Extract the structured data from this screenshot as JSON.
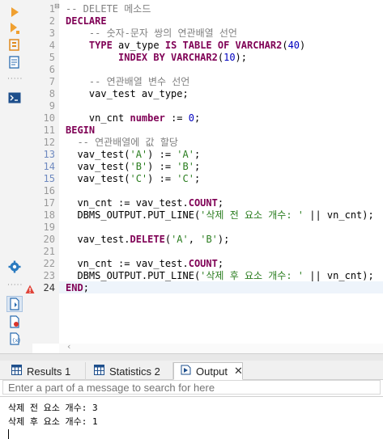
{
  "toolbar": {
    "icons": [
      "run-icon",
      "run-script-icon",
      "explain-plan-icon",
      "script-icon",
      "terminal-icon",
      "settings-icon",
      "active-file-icon",
      "file-error-icon",
      "variables-icon"
    ]
  },
  "editor": {
    "lines": [
      {
        "n": "1",
        "parts": [
          [
            "cm",
            "-- DELETE 메소드"
          ]
        ]
      },
      {
        "n": "2",
        "parts": [
          [
            "kw",
            "DECLARE"
          ]
        ]
      },
      {
        "n": "3",
        "parts": [
          [
            "",
            "    "
          ],
          [
            "cm",
            "-- 숫자-문자 쌍의 연관배열 선언"
          ]
        ]
      },
      {
        "n": "4",
        "parts": [
          [
            "",
            "    "
          ],
          [
            "kw",
            "TYPE"
          ],
          [
            "",
            " av_type "
          ],
          [
            "kw",
            "IS TABLE OF VARCHAR2"
          ],
          [
            "",
            "("
          ],
          [
            "num",
            "40"
          ],
          [
            "",
            ")"
          ]
        ]
      },
      {
        "n": "5",
        "parts": [
          [
            "",
            "         "
          ],
          [
            "kw",
            "INDEX BY VARCHAR2"
          ],
          [
            "",
            "("
          ],
          [
            "num",
            "10"
          ],
          [
            "",
            ");"
          ]
        ]
      },
      {
        "n": "6",
        "parts": []
      },
      {
        "n": "7",
        "parts": [
          [
            "",
            "    "
          ],
          [
            "cm",
            "-- 연관배열 변수 선언"
          ]
        ]
      },
      {
        "n": "8",
        "parts": [
          [
            "",
            "    vav_test av_type;"
          ]
        ]
      },
      {
        "n": "9",
        "parts": []
      },
      {
        "n": "10",
        "parts": [
          [
            "",
            "    vn_cnt "
          ],
          [
            "kw",
            "number"
          ],
          [
            "",
            " := "
          ],
          [
            "num",
            "0"
          ],
          [
            "",
            ";"
          ]
        ]
      },
      {
        "n": "11",
        "parts": [
          [
            "kw",
            "BEGIN"
          ]
        ]
      },
      {
        "n": "12",
        "parts": [
          [
            "",
            "  "
          ],
          [
            "cm",
            "-- 연관배열에 값 할당"
          ]
        ]
      },
      {
        "n": "13",
        "parts": [
          [
            "",
            "  vav_test("
          ],
          [
            "str",
            "'A'"
          ],
          [
            "",
            ") := "
          ],
          [
            "str",
            "'A'"
          ],
          [
            "",
            ";"
          ]
        ]
      },
      {
        "n": "14",
        "parts": [
          [
            "",
            "  vav_test("
          ],
          [
            "str",
            "'B'"
          ],
          [
            "",
            ") := "
          ],
          [
            "str",
            "'B'"
          ],
          [
            "",
            ";"
          ]
        ]
      },
      {
        "n": "15",
        "parts": [
          [
            "",
            "  vav_test("
          ],
          [
            "str",
            "'C'"
          ],
          [
            "",
            ") := "
          ],
          [
            "str",
            "'C'"
          ],
          [
            "",
            ";"
          ]
        ]
      },
      {
        "n": "16",
        "parts": []
      },
      {
        "n": "17",
        "parts": [
          [
            "",
            "  vn_cnt := vav_test."
          ],
          [
            "kw",
            "COUNT"
          ],
          [
            "",
            ";"
          ]
        ]
      },
      {
        "n": "18",
        "parts": [
          [
            "",
            "  DBMS_OUTPUT.PUT_LINE("
          ],
          [
            "str",
            "'삭제 전 요소 개수: '"
          ],
          [
            "",
            " || vn_cnt);"
          ]
        ]
      },
      {
        "n": "19",
        "parts": []
      },
      {
        "n": "20",
        "parts": [
          [
            "",
            "  vav_test."
          ],
          [
            "kw",
            "DELETE"
          ],
          [
            "",
            "("
          ],
          [
            "str",
            "'A'"
          ],
          [
            "",
            ", "
          ],
          [
            "str",
            "'B'"
          ],
          [
            "",
            ");"
          ]
        ]
      },
      {
        "n": "21",
        "parts": []
      },
      {
        "n": "22",
        "parts": [
          [
            "",
            "  vn_cnt := vav_test."
          ],
          [
            "kw",
            "COUNT"
          ],
          [
            "",
            ";"
          ]
        ]
      },
      {
        "n": "23",
        "parts": [
          [
            "",
            "  DBMS_OUTPUT.PUT_LINE("
          ],
          [
            "str",
            "'삭제 후 요소 개수: '"
          ],
          [
            "",
            " || vn_cnt);"
          ]
        ]
      },
      {
        "n": "24",
        "parts": [
          [
            "kw",
            "END"
          ],
          [
            "",
            ";"
          ]
        ]
      }
    ],
    "modified_lines": [
      "13",
      "14",
      "15"
    ],
    "current_line": "24",
    "warning_line": "23"
  },
  "panel": {
    "tabs": [
      {
        "label": "Results 1",
        "icon": "grid-icon",
        "active": false
      },
      {
        "label": "Statistics 2",
        "icon": "grid-icon",
        "active": false
      },
      {
        "label": "Output",
        "icon": "output-icon",
        "active": true
      }
    ],
    "search_placeholder": "Enter a part of a message to search for here",
    "output_lines": [
      "삭제 전 요소 개수: 3",
      "삭제 후 요소 개수: 1"
    ]
  },
  "colors": {
    "keyword": "#7f0055",
    "comment": "#808080",
    "string": "#2a7d1f",
    "number": "#0000c0",
    "run_icon": "#f0a030"
  }
}
